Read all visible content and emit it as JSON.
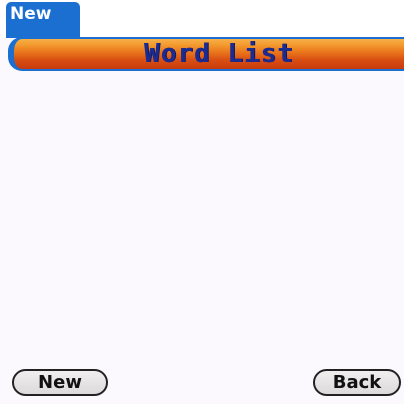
{
  "title_tab": {
    "label": "New"
  },
  "title_bar": {
    "label": "Word List"
  },
  "buttons": {
    "new_label": "New",
    "back_label": "Back"
  },
  "colors": {
    "tab_blue": "#1a6fd1",
    "title_orange": "#e9741b",
    "title_text": "#1c2b8f"
  }
}
